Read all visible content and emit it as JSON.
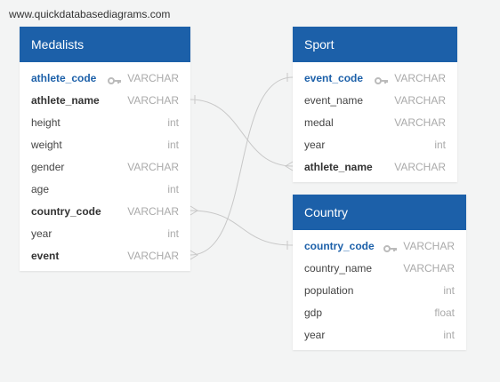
{
  "watermark": "www.quickdatabasediagrams.com",
  "colors": {
    "header": "#1c60a9",
    "primary_key_text": "#1c60a9",
    "type_text": "#aaaaaa",
    "connector": "#c8c8c8",
    "background": "#f3f4f4"
  },
  "tables": {
    "medalists": {
      "title": "Medalists",
      "rows": [
        {
          "name": "athlete_code",
          "type": "VARCHAR",
          "pk": true
        },
        {
          "name": "athlete_name",
          "type": "VARCHAR",
          "bold": true
        },
        {
          "name": "height",
          "type": "int"
        },
        {
          "name": "weight",
          "type": "int"
        },
        {
          "name": "gender",
          "type": "VARCHAR"
        },
        {
          "name": "age",
          "type": "int"
        },
        {
          "name": "country_code",
          "type": "VARCHAR",
          "bold": true
        },
        {
          "name": "year",
          "type": "int"
        },
        {
          "name": "event",
          "type": "VARCHAR",
          "bold": true
        }
      ]
    },
    "sport": {
      "title": "Sport",
      "rows": [
        {
          "name": "event_code",
          "type": "VARCHAR",
          "pk": true
        },
        {
          "name": "event_name",
          "type": "VARCHAR"
        },
        {
          "name": "medal",
          "type": "VARCHAR"
        },
        {
          "name": "year",
          "type": "int"
        },
        {
          "name": "athlete_name",
          "type": "VARCHAR",
          "bold": true
        }
      ]
    },
    "country": {
      "title": "Country",
      "rows": [
        {
          "name": "country_code",
          "type": "VARCHAR",
          "pk": true
        },
        {
          "name": "country_name",
          "type": "VARCHAR"
        },
        {
          "name": "population",
          "type": "int"
        },
        {
          "name": "gdp",
          "type": "float"
        },
        {
          "name": "year",
          "type": "int"
        }
      ]
    }
  }
}
